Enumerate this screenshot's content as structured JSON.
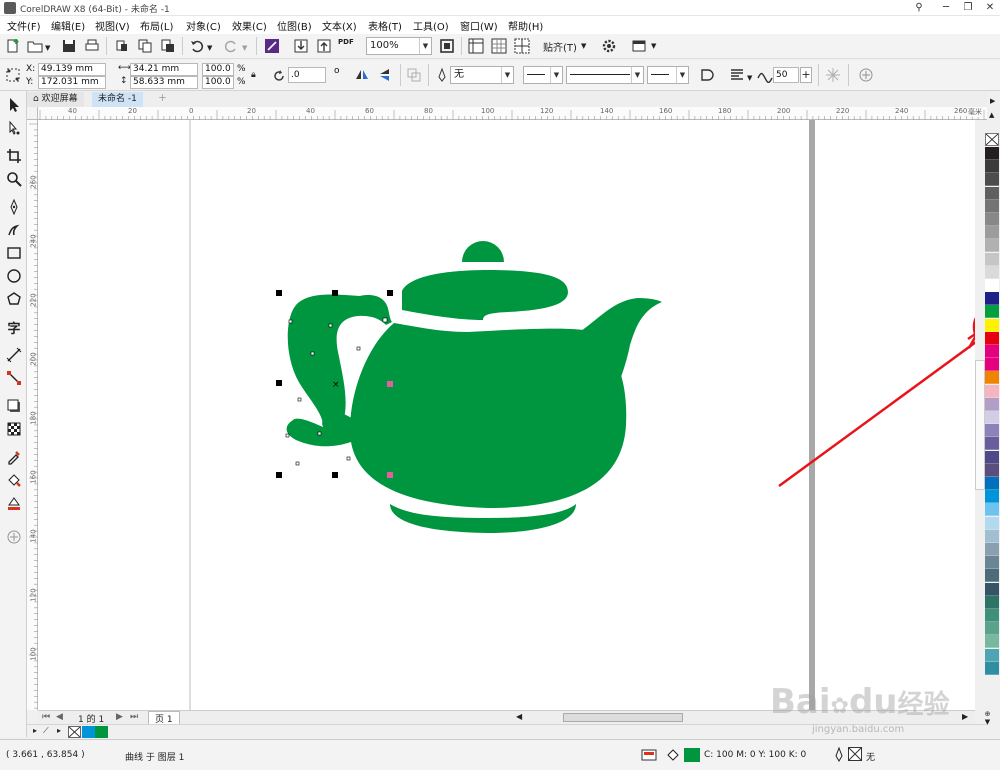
{
  "window": {
    "title": "CorelDRAW X8 (64-Bit) - 未命名 -1"
  },
  "menu": [
    "文件(F)",
    "编辑(E)",
    "视图(V)",
    "布局(L)",
    "对象(C)",
    "效果(C)",
    "位图(B)",
    "文本(X)",
    "表格(T)",
    "工具(O)",
    "窗口(W)",
    "帮助(H)"
  ],
  "toolbar": {
    "zoom": "100%",
    "snap_label": "贴齐(T)",
    "pdf_label": "PDF"
  },
  "properties": {
    "x_label": "X:",
    "x": "49.139 mm",
    "y_label": "Y:",
    "y": "172.031 mm",
    "width": "34.21 mm",
    "height": "58.633 mm",
    "scale_w": "100.0",
    "scale_h": "100.0",
    "pct": "%",
    "rotation": ".0",
    "degree": "o",
    "fill_none": "无",
    "smooth_value": "50"
  },
  "tabs": {
    "welcome": "欢迎屏幕",
    "document": "未命名 -1"
  },
  "rulers": {
    "h_ticks": [
      "40",
      "20",
      "0",
      "20",
      "40",
      "60",
      "80",
      "100",
      "120",
      "140",
      "160",
      "180",
      "200",
      "220",
      "240",
      "260"
    ],
    "h_unit": "毫米",
    "v_ticks": [
      "280",
      "260",
      "240",
      "220",
      "200",
      "180",
      "160",
      "140",
      "120",
      "100",
      "80",
      "60"
    ]
  },
  "page_nav": {
    "page_info": "1 的 1",
    "page_tab": "页 1"
  },
  "status": {
    "coords": "( 3.661 , 63.854 )",
    "selection": "曲线 于 图层 1",
    "fill_desc": "C: 100 M: 0 Y: 100 K: 0",
    "outline_desc": "无"
  },
  "watermark": {
    "brand": "Bai",
    "brand2": "du",
    "cn": "经验",
    "url": "jingyan.baidu.com"
  },
  "colors": {
    "teapot": "#00963f",
    "annotation": "#e8141b",
    "palette": [
      "#231f20",
      "#3b3b3b",
      "#4d4d4d",
      "#606060",
      "#747474",
      "#888888",
      "#9c9c9c",
      "#b1b1b1",
      "#c6c6c6",
      "#dadada",
      "#ffffff",
      "#1d2088",
      "#00a040",
      "#fff100",
      "#e60012",
      "#e4007f",
      "#e4007f",
      "#f08300",
      "#f4b4c0",
      "#b0a0c8",
      "#d3cde6",
      "#8e82bb",
      "#6a5d9e",
      "#4f4a86",
      "#5a4f7c",
      "#0072bc",
      "#0095d9",
      "#6ec3ee",
      "#b3d9ef",
      "#a3bfcf",
      "#8aa0ae",
      "#6a8696",
      "#4e6b79",
      "#355465",
      "#2d7367",
      "#3f8f7b",
      "#5aa38a",
      "#7ab89d",
      "#4fa4b4",
      "#2f8fa0"
    ]
  }
}
